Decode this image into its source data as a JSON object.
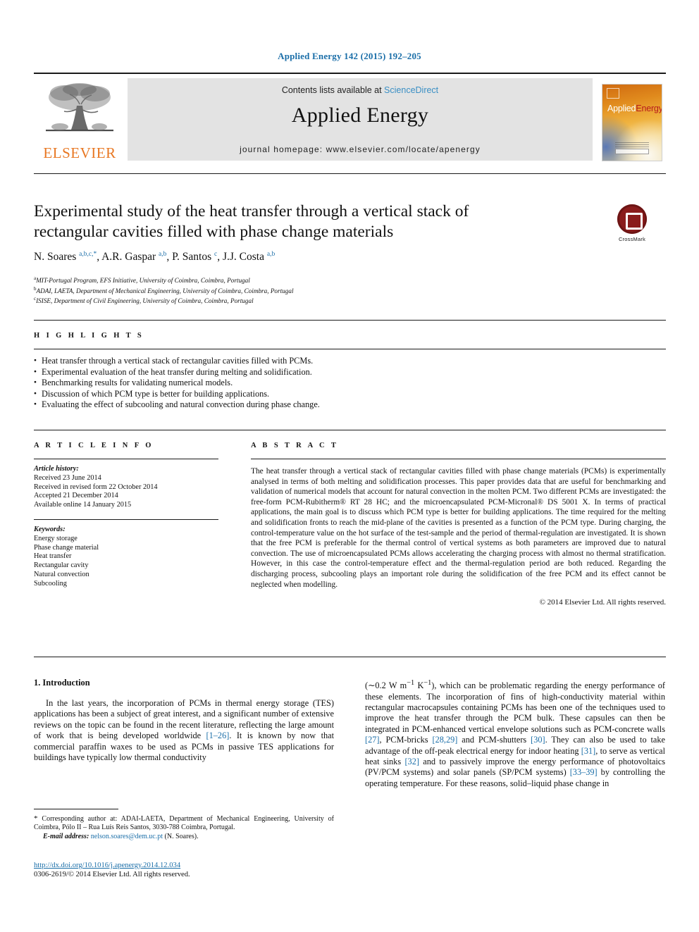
{
  "running_head": "Applied Energy 142 (2015) 192–205",
  "masthead": {
    "publisher_wordmark": "ELSEVIER",
    "contents_prefix": "Contents lists available at ",
    "contents_link": "ScienceDirect",
    "journal_title": "Applied Energy",
    "homepage_line": "journal homepage: www.elsevier.com/locate/apenergy",
    "cover_title_part1": "Applied",
    "cover_title_part2": "Energy",
    "accent_link_color": "#3a8fc4",
    "publisher_color": "#e87722"
  },
  "article": {
    "title": "Experimental study of the heat transfer through a vertical stack of rectangular cavities filled with phase change materials",
    "authors_html": "N. Soares <sup>a,b,c,</sup><sup>*</sup>, A.R. Gaspar <sup>a,b</sup>, P. Santos <sup>c</sup>, J.J. Costa <sup>a,b</sup>",
    "affiliations": [
      {
        "marker": "a",
        "text": "MIT-Portugal Program, EFS Initiative, University of Coimbra, Coimbra, Portugal"
      },
      {
        "marker": "b",
        "text": "ADAI, LAETA, Department of Mechanical Engineering, University of Coimbra, Coimbra, Portugal"
      },
      {
        "marker": "c",
        "text": "ISISE, Department of Civil Engineering, University of Coimbra, Coimbra, Portugal"
      }
    ],
    "crossmark_label": "CrossMark"
  },
  "highlights": {
    "heading": "H I G H L I G H T S",
    "items": [
      "Heat transfer through a vertical stack of rectangular cavities filled with PCMs.",
      "Experimental evaluation of the heat transfer during melting and solidification.",
      "Benchmarking results for validating numerical models.",
      "Discussion of which PCM type is better for building applications.",
      "Evaluating the effect of subcooling and natural convection during phase change."
    ]
  },
  "article_info": {
    "heading": "A R T I C L E    I N F O",
    "history_label": "Article history:",
    "history": [
      "Received 23 June 2014",
      "Received in revised form 22 October 2014",
      "Accepted 21 December 2014",
      "Available online 14 January 2015"
    ],
    "keywords_label": "Keywords:",
    "keywords": [
      "Energy storage",
      "Phase change material",
      "Heat transfer",
      "Rectangular cavity",
      "Natural convection",
      "Subcooling"
    ]
  },
  "abstract": {
    "heading": "A B S T R A C T",
    "text": "The heat transfer through a vertical stack of rectangular cavities filled with phase change materials (PCMs) is experimentally analysed in terms of both melting and solidification processes. This paper provides data that are useful for benchmarking and validation of numerical models that account for natural convection in the molten PCM. Two different PCMs are investigated: the free-form PCM-Rubitherm® RT 28 HC; and the microencapsulated PCM-Micronal® DS 5001 X. In terms of practical applications, the main goal is to discuss which PCM type is better for building applications. The time required for the melting and solidification fronts to reach the mid-plane of the cavities is presented as a function of the PCM type. During charging, the control-temperature value on the hot surface of the test-sample and the period of thermal-regulation are investigated. It is shown that the free PCM is preferable for the thermal control of vertical systems as both parameters are improved due to natural convection. The use of microencapsulated PCMs allows accelerating the charging process with almost no thermal stratification. However, in this case the control-temperature effect and the thermal-regulation period are both reduced. Regarding the discharging process, subcooling plays an important role during the solidification of the free PCM and its effect cannot be neglected when modelling.",
    "copyright": "© 2014 Elsevier Ltd. All rights reserved."
  },
  "body": {
    "section_heading": "1. Introduction",
    "left_paragraph_html": "In the last years, the incorporation of PCMs in thermal energy storage (TES) applications has been a subject of great interest, and a significant number of extensive reviews on the topic can be found in the recent literature, reflecting the large amount of work that is being developed worldwide <span class=\"reflink\">[1–26]</span>. It is known by now that commercial paraffin waxes to be used as PCMs in passive TES applications for buildings have typically low thermal conductivity",
    "right_paragraph_html": "(∼0.2 W m<sup>−1</sup> K<sup>−1</sup>), which can be problematic regarding the energy performance of these elements. The incorporation of fins of high-conductivity material within rectangular macrocapsules containing PCMs has been one of the techniques used to improve the heat transfer through the PCM bulk. These capsules can then be integrated in PCM-enhanced vertical envelope solutions such as PCM-concrete walls <span class=\"reflink\">[27]</span>, PCM-bricks <span class=\"reflink\">[28,29]</span> and PCM-shutters <span class=\"reflink\">[30]</span>. They can also be used to take advantage of the off-peak electrical energy for indoor heating <span class=\"reflink\">[31]</span>, to serve as vertical heat sinks <span class=\"reflink\">[32]</span> and to passively improve the energy performance of photovoltaics (PV/PCM systems) and solar panels (SP/PCM systems) <span class=\"reflink\">[33–39]</span> by controlling the operating temperature. For these reasons, solid–liquid phase change in"
  },
  "footnote": {
    "corresponding_html": "<span class=\"star\">*</span> Corresponding author at: ADAI-LAETA, Department of Mechanical Engineering, University of Coimbra, Pólo II – Rua Luís Reis Santos, 3030-788 Coimbra, Portugal.",
    "email_label": "E-mail address:",
    "email": "nelson.soares@dem.uc.pt",
    "email_owner": "(N. Soares)."
  },
  "doi_block": {
    "doi_url": "http://dx.doi.org/10.1016/j.apenergy.2014.12.034",
    "issn_line": "0306-2619/© 2014 Elsevier Ltd. All rights reserved."
  }
}
